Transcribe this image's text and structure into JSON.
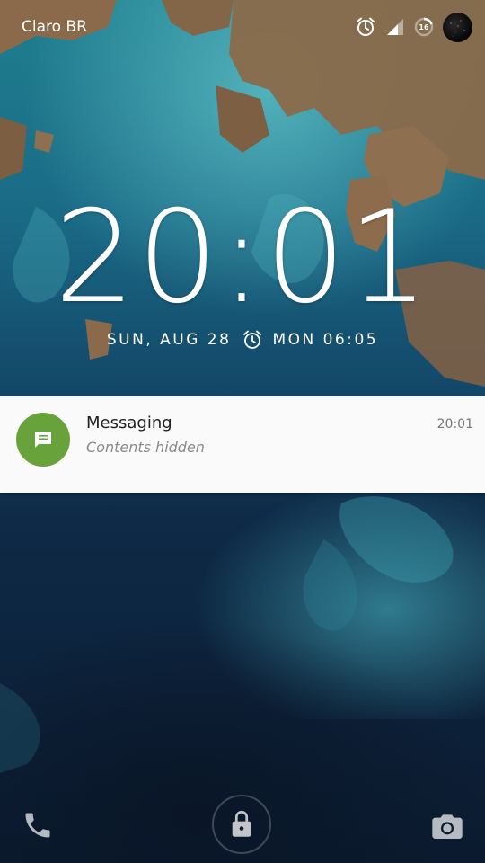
{
  "status_bar": {
    "carrier": "Claro BR",
    "battery_level": "16",
    "icons": [
      "alarm-icon",
      "signal-icon",
      "battery-icon",
      "avatar"
    ]
  },
  "lockscreen": {
    "time": "20:01",
    "date": "SUN, AUG 28",
    "next_alarm": "MON 06:05"
  },
  "notification": {
    "app_name": "Messaging",
    "content": "Contents hidden",
    "time": "20:01",
    "icon": "message-icon",
    "accent_color": "#67a33a"
  },
  "bottom_actions": {
    "left": "phone-icon",
    "center": "lock-icon",
    "right": "camera-icon"
  }
}
